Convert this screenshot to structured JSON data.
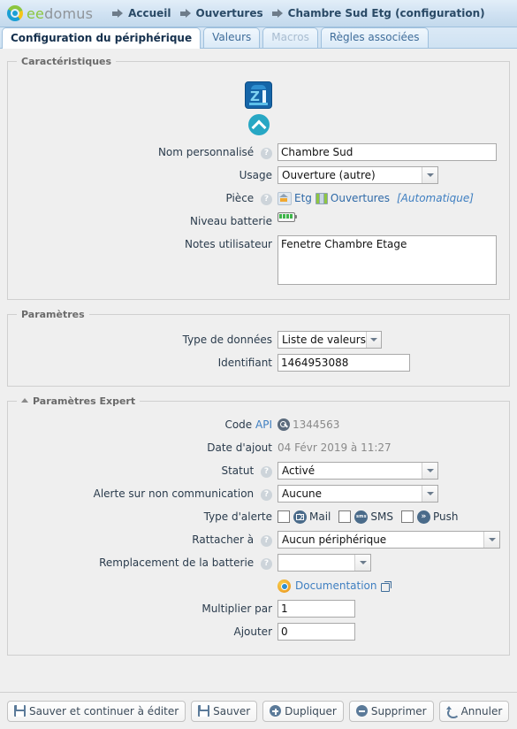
{
  "header": {
    "brand_ee": "ee",
    "brand_domus": "domus",
    "breadcrumbs": [
      "Accueil",
      "Ouvertures",
      "Chambre Sud Etg (configuration)"
    ]
  },
  "tabs": [
    {
      "label": "Configuration du périphérique",
      "state": "active"
    },
    {
      "label": "Valeurs",
      "state": "normal"
    },
    {
      "label": "Macros",
      "state": "disabled"
    },
    {
      "label": "Règles associées",
      "state": "normal"
    }
  ],
  "sections": {
    "caracteristiques": {
      "legend": "Caractéristiques",
      "device_icon": "zipato-device-icon",
      "state_icon": "chevron-up-icon",
      "fields": {
        "nom_label": "Nom personnalisé",
        "nom_value": "Chambre Sud",
        "usage_label": "Usage",
        "usage_value": "Ouverture (autre)",
        "piece_label": "Pièce",
        "piece_room": "Etg",
        "piece_group": "Ouvertures",
        "piece_auto": "[Automatique]",
        "batterie_label": "Niveau batterie",
        "batterie_cells": 4,
        "notes_label": "Notes utilisateur",
        "notes_value": "Fenetre Chambre Etage"
      }
    },
    "parametres": {
      "legend": "Paramètres",
      "fields": {
        "type_label": "Type de données",
        "type_value": "Liste de valeurs",
        "identifiant_label": "Identifiant",
        "identifiant_value": "1464953088"
      }
    },
    "expert": {
      "legend": "Paramètres Expert",
      "fields": {
        "code_label": "Code",
        "code_api_word": "API",
        "code_value": "1344563",
        "date_label": "Date d'ajout",
        "date_value": "04 Févr 2019 à 11:27",
        "statut_label": "Statut",
        "statut_value": "Activé",
        "alerte_label": "Alerte sur non communication",
        "alerte_value": "Aucune",
        "type_alerte_label": "Type d'alerte",
        "alerte_mail": "Mail",
        "alerte_sms": "SMS",
        "alerte_push": "Push",
        "alerte_sms_badge": "sms",
        "alerte_push_badge": "»",
        "rattacher_label": "Rattacher à",
        "rattacher_value": "Aucun périphérique",
        "remplacement_label": "Remplacement de la batterie",
        "remplacement_value": "",
        "documentation_label": "Documentation",
        "multiplier_label": "Multiplier par",
        "multiplier_value": "1",
        "ajouter_label": "Ajouter",
        "ajouter_value": "0"
      }
    }
  },
  "footer": {
    "save_continue": "Sauver et continuer à éditer",
    "save": "Sauver",
    "duplicate": "Dupliquer",
    "delete": "Supprimer",
    "cancel": "Annuler"
  },
  "help_glyph": "?",
  "colors": {
    "accent_link": "#3f7fc1",
    "brand_green": "#8cc63e",
    "brand_blue": "#1a9fd4",
    "battery_green": "#3eb54a",
    "device_blue": "#1565a8"
  }
}
